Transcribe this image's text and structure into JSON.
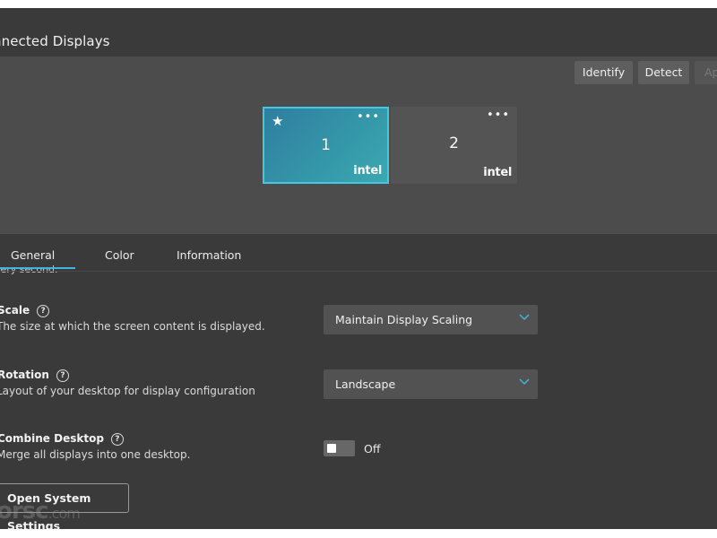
{
  "window": {
    "minimize_glyph": "—"
  },
  "header": {
    "title": "nnected Displays"
  },
  "toolbar": {
    "identify_label": "Identify",
    "detect_label": "Detect",
    "apply_label": "Ap"
  },
  "displays": [
    {
      "number": "1",
      "vendor": "intel",
      "primary": true,
      "menu": "•••"
    },
    {
      "number": "2",
      "vendor": "intel",
      "primary": false,
      "menu": "•••"
    }
  ],
  "tabs": [
    {
      "label": "General",
      "active": true
    },
    {
      "label": "Color",
      "active": false
    },
    {
      "label": "Information",
      "active": false
    }
  ],
  "partial_text": "very second.",
  "settings": {
    "scale": {
      "title": "Scale",
      "description": "The size at which the screen content is displayed.",
      "value": "Maintain Display Scaling"
    },
    "rotation": {
      "title": "Rotation",
      "description": "Layout of your desktop for display configuration",
      "value": "Landscape"
    },
    "combine": {
      "title": "Combine Desktop",
      "description": "Merge all displays into one desktop.",
      "toggle_state": "Off"
    }
  },
  "open_system_settings_label": "Open System Settings",
  "watermark": {
    "main": "orsc",
    "suffix": ".com"
  },
  "colors": {
    "accent": "#3fb7dd",
    "panel": "#3a3a3a",
    "display_area": "#4c4c4c"
  },
  "icons": {
    "primary": "star-icon",
    "help": "help-circle-icon",
    "dropdown": "chevron-down-icon",
    "menu": "more-dots-icon"
  }
}
